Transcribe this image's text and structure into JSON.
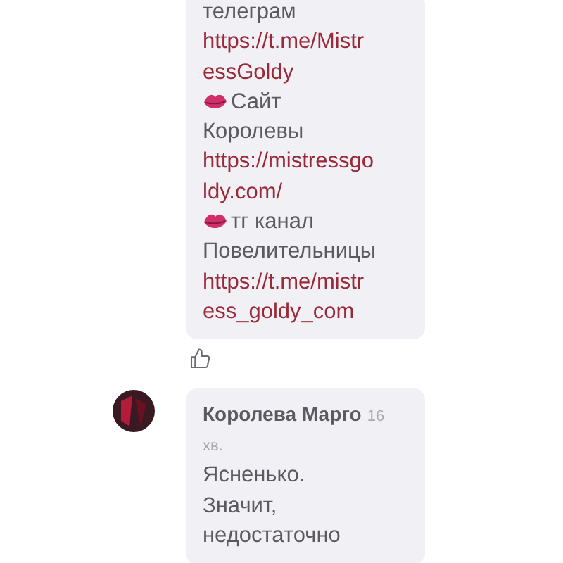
{
  "messages": [
    {
      "lines": [
        {
          "kind": "text",
          "text": "телеграм"
        },
        {
          "kind": "link",
          "text": "https://t.me/Mistr"
        },
        {
          "kind": "link",
          "text": "essGoldy"
        },
        {
          "kind": "marked",
          "text": "Сайт"
        },
        {
          "kind": "text",
          "text": "Королевы"
        },
        {
          "kind": "link",
          "text": "https://mistressgo"
        },
        {
          "kind": "link",
          "text": "ldy.com/"
        },
        {
          "kind": "marked",
          "text": "тг канал"
        },
        {
          "kind": "text",
          "text": "Повелительницы"
        },
        {
          "kind": "link",
          "text": "https://t.me/mistr"
        },
        {
          "kind": "link",
          "text": "ess_goldy_com"
        }
      ],
      "liked": false
    },
    {
      "author": "Королева Марго",
      "time": "16",
      "time_unit": "хв.",
      "lines": [
        {
          "kind": "text",
          "text": "Ясненько."
        },
        {
          "kind": "text",
          "text": "Значит,"
        },
        {
          "kind": "text",
          "text": "недостаточно"
        }
      ]
    }
  ]
}
